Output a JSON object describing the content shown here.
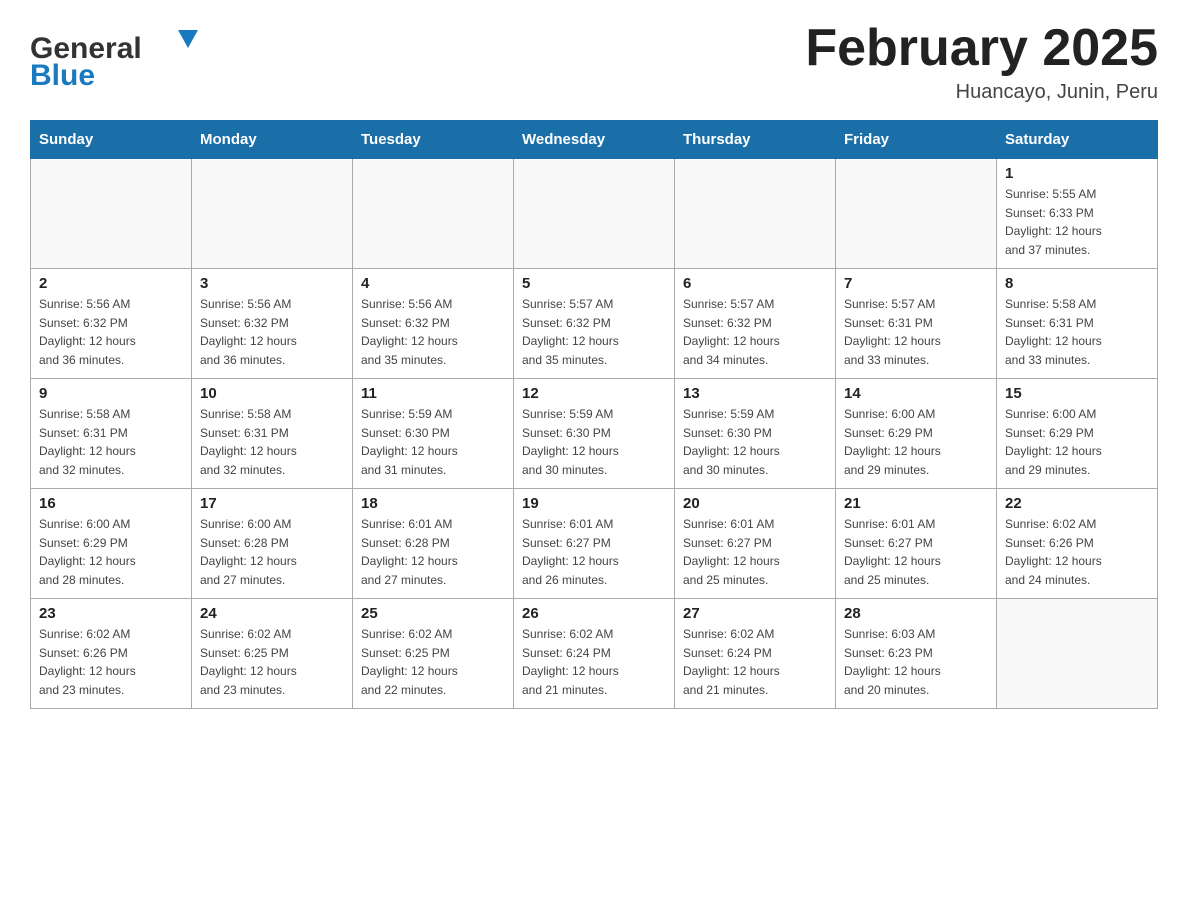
{
  "header": {
    "logo_general": "General",
    "logo_blue": "Blue",
    "month": "February 2025",
    "location": "Huancayo, Junin, Peru"
  },
  "weekdays": [
    "Sunday",
    "Monday",
    "Tuesday",
    "Wednesday",
    "Thursday",
    "Friday",
    "Saturday"
  ],
  "weeks": [
    [
      {
        "day": "",
        "info": ""
      },
      {
        "day": "",
        "info": ""
      },
      {
        "day": "",
        "info": ""
      },
      {
        "day": "",
        "info": ""
      },
      {
        "day": "",
        "info": ""
      },
      {
        "day": "",
        "info": ""
      },
      {
        "day": "1",
        "info": "Sunrise: 5:55 AM\nSunset: 6:33 PM\nDaylight: 12 hours\nand 37 minutes."
      }
    ],
    [
      {
        "day": "2",
        "info": "Sunrise: 5:56 AM\nSunset: 6:32 PM\nDaylight: 12 hours\nand 36 minutes."
      },
      {
        "day": "3",
        "info": "Sunrise: 5:56 AM\nSunset: 6:32 PM\nDaylight: 12 hours\nand 36 minutes."
      },
      {
        "day": "4",
        "info": "Sunrise: 5:56 AM\nSunset: 6:32 PM\nDaylight: 12 hours\nand 35 minutes."
      },
      {
        "day": "5",
        "info": "Sunrise: 5:57 AM\nSunset: 6:32 PM\nDaylight: 12 hours\nand 35 minutes."
      },
      {
        "day": "6",
        "info": "Sunrise: 5:57 AM\nSunset: 6:32 PM\nDaylight: 12 hours\nand 34 minutes."
      },
      {
        "day": "7",
        "info": "Sunrise: 5:57 AM\nSunset: 6:31 PM\nDaylight: 12 hours\nand 33 minutes."
      },
      {
        "day": "8",
        "info": "Sunrise: 5:58 AM\nSunset: 6:31 PM\nDaylight: 12 hours\nand 33 minutes."
      }
    ],
    [
      {
        "day": "9",
        "info": "Sunrise: 5:58 AM\nSunset: 6:31 PM\nDaylight: 12 hours\nand 32 minutes."
      },
      {
        "day": "10",
        "info": "Sunrise: 5:58 AM\nSunset: 6:31 PM\nDaylight: 12 hours\nand 32 minutes."
      },
      {
        "day": "11",
        "info": "Sunrise: 5:59 AM\nSunset: 6:30 PM\nDaylight: 12 hours\nand 31 minutes."
      },
      {
        "day": "12",
        "info": "Sunrise: 5:59 AM\nSunset: 6:30 PM\nDaylight: 12 hours\nand 30 minutes."
      },
      {
        "day": "13",
        "info": "Sunrise: 5:59 AM\nSunset: 6:30 PM\nDaylight: 12 hours\nand 30 minutes."
      },
      {
        "day": "14",
        "info": "Sunrise: 6:00 AM\nSunset: 6:29 PM\nDaylight: 12 hours\nand 29 minutes."
      },
      {
        "day": "15",
        "info": "Sunrise: 6:00 AM\nSunset: 6:29 PM\nDaylight: 12 hours\nand 29 minutes."
      }
    ],
    [
      {
        "day": "16",
        "info": "Sunrise: 6:00 AM\nSunset: 6:29 PM\nDaylight: 12 hours\nand 28 minutes."
      },
      {
        "day": "17",
        "info": "Sunrise: 6:00 AM\nSunset: 6:28 PM\nDaylight: 12 hours\nand 27 minutes."
      },
      {
        "day": "18",
        "info": "Sunrise: 6:01 AM\nSunset: 6:28 PM\nDaylight: 12 hours\nand 27 minutes."
      },
      {
        "day": "19",
        "info": "Sunrise: 6:01 AM\nSunset: 6:27 PM\nDaylight: 12 hours\nand 26 minutes."
      },
      {
        "day": "20",
        "info": "Sunrise: 6:01 AM\nSunset: 6:27 PM\nDaylight: 12 hours\nand 25 minutes."
      },
      {
        "day": "21",
        "info": "Sunrise: 6:01 AM\nSunset: 6:27 PM\nDaylight: 12 hours\nand 25 minutes."
      },
      {
        "day": "22",
        "info": "Sunrise: 6:02 AM\nSunset: 6:26 PM\nDaylight: 12 hours\nand 24 minutes."
      }
    ],
    [
      {
        "day": "23",
        "info": "Sunrise: 6:02 AM\nSunset: 6:26 PM\nDaylight: 12 hours\nand 23 minutes."
      },
      {
        "day": "24",
        "info": "Sunrise: 6:02 AM\nSunset: 6:25 PM\nDaylight: 12 hours\nand 23 minutes."
      },
      {
        "day": "25",
        "info": "Sunrise: 6:02 AM\nSunset: 6:25 PM\nDaylight: 12 hours\nand 22 minutes."
      },
      {
        "day": "26",
        "info": "Sunrise: 6:02 AM\nSunset: 6:24 PM\nDaylight: 12 hours\nand 21 minutes."
      },
      {
        "day": "27",
        "info": "Sunrise: 6:02 AM\nSunset: 6:24 PM\nDaylight: 12 hours\nand 21 minutes."
      },
      {
        "day": "28",
        "info": "Sunrise: 6:03 AM\nSunset: 6:23 PM\nDaylight: 12 hours\nand 20 minutes."
      },
      {
        "day": "",
        "info": ""
      }
    ]
  ]
}
